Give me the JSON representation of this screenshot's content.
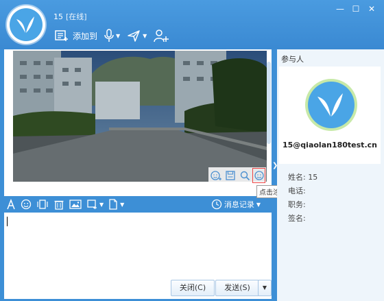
{
  "contact": {
    "name": "15",
    "status": "[在线]"
  },
  "toolbar": {
    "add_to_label": "添加到"
  },
  "image_tools": {
    "tooltip": "点击涂鸦"
  },
  "input_toolbar": {
    "history_label": "消息记录"
  },
  "buttons": {
    "close": "关闭(C)",
    "send": "发送(S)"
  },
  "right_panel": {
    "section_title": "参与人",
    "email": "15@qiaolan180test.cn",
    "name_label": "姓名:",
    "name_value": "15",
    "phone_label": "电话:",
    "title_label": "职务:",
    "signature_label": "签名:"
  },
  "colors": {
    "primary": "#3d8fd6",
    "panel": "#eef5fb",
    "highlight": "#e44444"
  }
}
